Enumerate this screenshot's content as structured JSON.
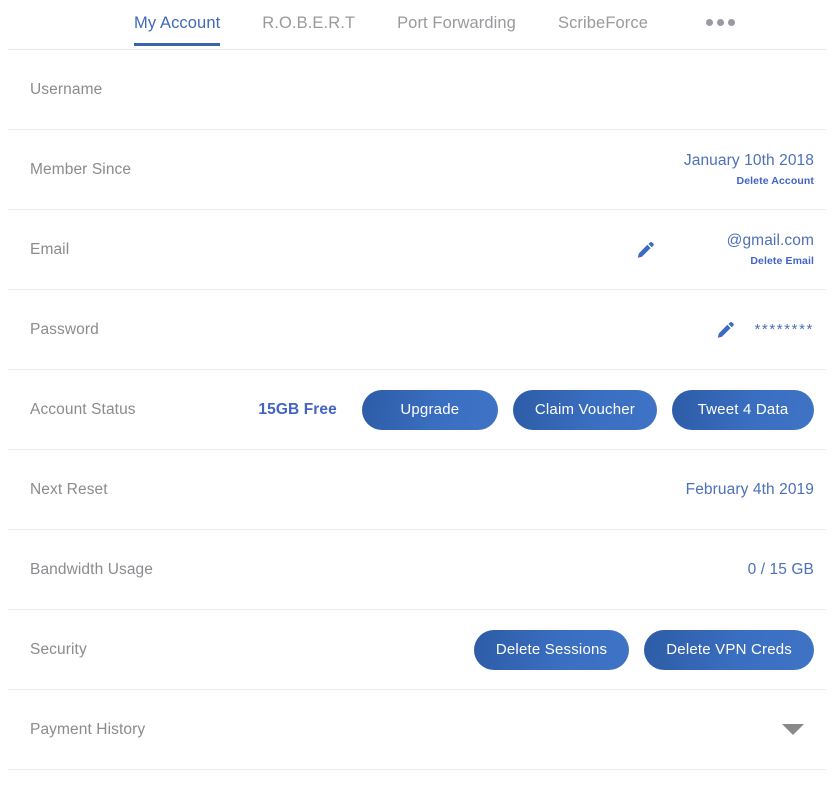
{
  "colors": {
    "accent_blue": "#3f6ab8",
    "link_blue": "#4263c6",
    "value_blue": "#4d70b8",
    "label_grey": "#8b8b8f",
    "tab_inactive_grey": "#9a9a9e",
    "divider_grey": "#ececec",
    "button_gradient_start": "#2d5ca6",
    "button_gradient_end": "#3f73c6",
    "chevron_grey": "#8a8a8a"
  },
  "tabs": [
    {
      "label": "My Account",
      "active": true
    },
    {
      "label": "R.O.B.E.R.T",
      "active": false
    },
    {
      "label": "Port Forwarding",
      "active": false
    },
    {
      "label": "ScribeForce",
      "active": false
    }
  ],
  "overflow_menu": {
    "icon": "more-horizontal-icon",
    "dots": 3
  },
  "rows": {
    "username": {
      "label": "Username",
      "value": ""
    },
    "member_since": {
      "label": "Member Since",
      "value": "January 10th 2018",
      "sub_link": "Delete Account"
    },
    "email": {
      "label": "Email",
      "value": "@gmail.com",
      "sub_link": "Delete Email",
      "edit_icon": "pencil-icon"
    },
    "password": {
      "label": "Password",
      "value": "********",
      "edit_icon": "pencil-icon"
    },
    "account_status": {
      "label": "Account Status",
      "status": "15GB Free",
      "buttons": [
        {
          "label": "Upgrade"
        },
        {
          "label": "Claim Voucher"
        },
        {
          "label": "Tweet 4 Data"
        }
      ]
    },
    "next_reset": {
      "label": "Next Reset",
      "value": "February 4th 2019"
    },
    "bandwidth_usage": {
      "label": "Bandwidth Usage",
      "value": "0 / 15 GB"
    },
    "security": {
      "label": "Security",
      "buttons": [
        {
          "label": "Delete Sessions"
        },
        {
          "label": "Delete VPN Creds"
        }
      ]
    },
    "payment_history": {
      "label": "Payment History",
      "expander_icon": "chevron-down-icon"
    }
  }
}
